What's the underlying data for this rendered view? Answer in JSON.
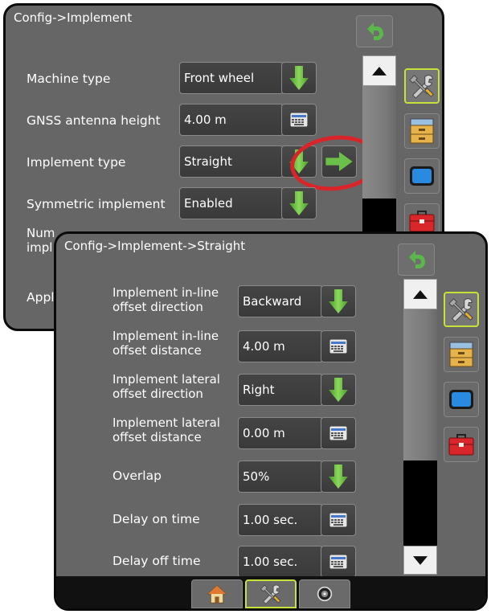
{
  "back_window": {
    "title": "Config->Implement",
    "rows": [
      {
        "label": "Machine type",
        "value": "Front wheel",
        "action": "dropdown"
      },
      {
        "label": "GNSS antenna height",
        "value": "4.00 m",
        "action": "keyboard"
      },
      {
        "label": "Implement type",
        "value": "Straight",
        "action": "dropdown"
      },
      {
        "label": "Symmetric implement",
        "value": "Enabled",
        "action": "dropdown"
      },
      {
        "label": "Num",
        "label2": "impl",
        "value": "",
        "action": ""
      },
      {
        "label": "Appl",
        "value": "",
        "action": ""
      }
    ],
    "next_button_icon": "arrow-right-icon",
    "highlight_color": "#d9252a"
  },
  "front_window": {
    "title": "Config->Implement->Straight",
    "rows": [
      {
        "label": "Implement in-line",
        "label2": "offset direction",
        "value": "Backward",
        "action": "dropdown"
      },
      {
        "label": "Implement in-line",
        "label2": "offset distance",
        "value": "4.00 m",
        "action": "keyboard"
      },
      {
        "label": "Implement lateral",
        "label2": "offset direction",
        "value": "Right",
        "action": "dropdown"
      },
      {
        "label": "Implement lateral",
        "label2": "offset distance",
        "value": "0.00 m",
        "action": "keyboard"
      },
      {
        "label": "Overlap",
        "value": "50%",
        "action": "dropdown"
      },
      {
        "label": "Delay on time",
        "value": "1.00 sec.",
        "action": "keyboard"
      },
      {
        "label": "Delay off time",
        "value": "1.00 sec.",
        "action": "keyboard"
      }
    ],
    "side_menu": [
      "tools-icon",
      "file-cabinet-icon",
      "display-icon",
      "toolbox-icon"
    ],
    "bottom_tabs": [
      "home-icon",
      "tools-icon",
      "gauge-icon"
    ]
  },
  "colors": {
    "panel": "#666666",
    "frame": "#0a0a0a",
    "arrow_green": "#6cc04a",
    "active_border": "#c8e03c",
    "back_arrow": "#5ab84a"
  }
}
